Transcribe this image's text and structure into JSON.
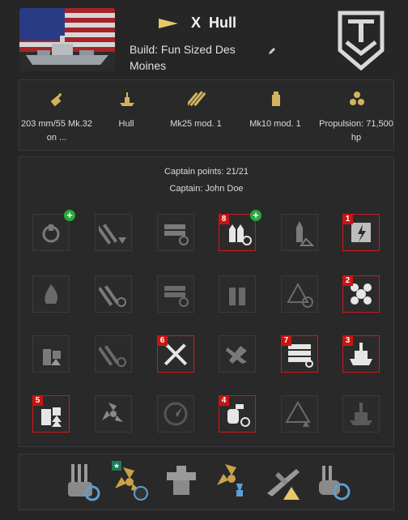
{
  "ship": {
    "tier": "X",
    "name": "Hull",
    "build": "Build: Fun Sized Des Moines"
  },
  "modules": [
    {
      "label": "203 mm/55 Mk.32 on ...",
      "icon": "main-battery-icon"
    },
    {
      "label": "Hull",
      "icon": "hull-icon"
    },
    {
      "label": "Mk25 mod. 1",
      "icon": "torpedo-icon"
    },
    {
      "label": "Mk10 mod. 1",
      "icon": "fire-control-icon"
    },
    {
      "label": "Propulsion: 71,500 hp",
      "icon": "propulsion-icon"
    }
  ],
  "captain": {
    "points": "Captain points: 21/21",
    "name": "Captain: John Doe"
  },
  "skills": [
    {
      "row": 0,
      "col": 0,
      "icon": "gear-reload-icon",
      "badge": "",
      "plus": true
    },
    {
      "row": 0,
      "col": 1,
      "icon": "torpedo-aim-icon",
      "badge": "",
      "plus": false
    },
    {
      "row": 0,
      "col": 2,
      "icon": "torpedo-reload-icon",
      "badge": "",
      "plus": false
    },
    {
      "row": 0,
      "col": 3,
      "icon": "shell-reload-icon",
      "badge": "8",
      "plus": true
    },
    {
      "row": 0,
      "col": 4,
      "icon": "shell-warning-icon",
      "badge": "",
      "plus": false
    },
    {
      "row": 0,
      "col": 5,
      "icon": "lightning-armor-icon",
      "badge": "1",
      "plus": false
    },
    {
      "row": 1,
      "col": 0,
      "icon": "fire-icon",
      "badge": "",
      "plus": false
    },
    {
      "row": 1,
      "col": 1,
      "icon": "torpedo-speed-icon",
      "badge": "",
      "plus": false
    },
    {
      "row": 1,
      "col": 2,
      "icon": "torpedo-tube-icon",
      "badge": "",
      "plus": false
    },
    {
      "row": 1,
      "col": 3,
      "icon": "shells-icon",
      "badge": "",
      "plus": false
    },
    {
      "row": 1,
      "col": 4,
      "icon": "warning-target-icon",
      "badge": "",
      "plus": false
    },
    {
      "row": 1,
      "col": 5,
      "icon": "radiation-fan-icon",
      "badge": "2",
      "plus": false
    },
    {
      "row": 2,
      "col": 0,
      "icon": "aa-upgrade-icon",
      "badge": "",
      "plus": false
    },
    {
      "row": 2,
      "col": 1,
      "icon": "torpedo-reload-2-icon",
      "badge": "",
      "plus": false
    },
    {
      "row": 2,
      "col": 2,
      "icon": "crossed-tools-icon",
      "badge": "6",
      "plus": false
    },
    {
      "row": 2,
      "col": 3,
      "icon": "aircraft-down-icon",
      "badge": "",
      "plus": false
    },
    {
      "row": 2,
      "col": 4,
      "icon": "torpedo-rack-icon",
      "badge": "7",
      "plus": false
    },
    {
      "row": 2,
      "col": 5,
      "icon": "ship-hull-icon",
      "badge": "3",
      "plus": false
    },
    {
      "row": 3,
      "col": 0,
      "icon": "aa-double-upgrade-icon",
      "badge": "5",
      "plus": false
    },
    {
      "row": 3,
      "col": 1,
      "icon": "propeller-upgrade-icon",
      "badge": "",
      "plus": false
    },
    {
      "row": 3,
      "col": 2,
      "icon": "radar-icon",
      "badge": "",
      "plus": false
    },
    {
      "row": 3,
      "col": 3,
      "icon": "smoke-reload-icon",
      "badge": "4",
      "plus": false
    },
    {
      "row": 3,
      "col": 4,
      "icon": "warning-down-icon",
      "badge": "",
      "plus": false
    },
    {
      "row": 3,
      "col": 5,
      "icon": "ship-silhouette-icon",
      "badge": "",
      "plus": false
    }
  ],
  "upgrades": [
    {
      "icon": "main-armaments-mod-icon",
      "star": false
    },
    {
      "icon": "propulsion-timer-mod-icon",
      "star": true
    },
    {
      "icon": "steering-gear-mod-icon",
      "star": false
    },
    {
      "icon": "propulsion-upgrade-icon",
      "star": false
    },
    {
      "icon": "aircraft-warning-mod-icon",
      "star": false
    },
    {
      "icon": "guns-reload-mod-icon",
      "star": false
    }
  ],
  "colors": {
    "accent": "#e8c66a",
    "selected": "#d01818",
    "plus": "#29a83a",
    "panel": "#292929"
  }
}
